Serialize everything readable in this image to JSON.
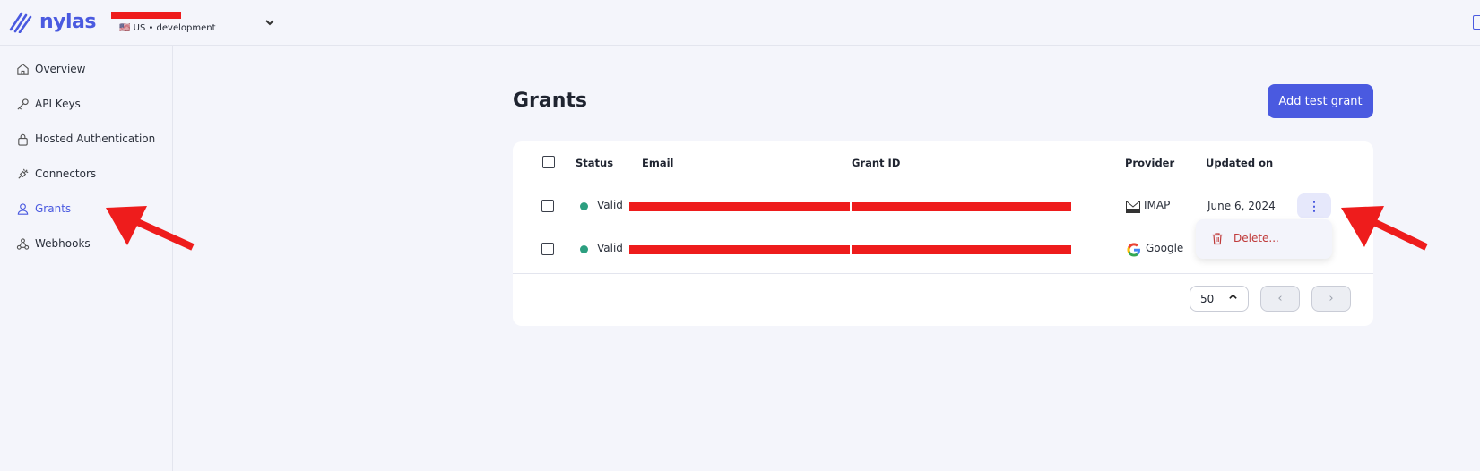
{
  "header": {
    "logo_text": "nylas",
    "env_label": "🇺🇸 US • development"
  },
  "sidebar": {
    "items": [
      {
        "label": "Overview",
        "icon": "home-icon"
      },
      {
        "label": "API Keys",
        "icon": "key-icon"
      },
      {
        "label": "Hosted Authentication",
        "icon": "lock-icon"
      },
      {
        "label": "Connectors",
        "icon": "plug-icon"
      },
      {
        "label": "Grants",
        "icon": "user-icon",
        "active": true
      },
      {
        "label": "Webhooks",
        "icon": "webhook-icon"
      }
    ]
  },
  "main": {
    "title": "Grants",
    "add_button": "Add test grant",
    "table": {
      "headers": [
        "Status",
        "Email",
        "Grant ID",
        "Provider",
        "Updated on"
      ],
      "rows": [
        {
          "status": "Valid",
          "provider": "IMAP",
          "updated": "June 6, 2024"
        },
        {
          "status": "Valid",
          "provider": "Google",
          "updated": ""
        }
      ]
    },
    "pagination": {
      "per_page": "50",
      "prev": "‹",
      "next": "›"
    },
    "row_menu": {
      "delete_label": "Delete..."
    }
  },
  "colors": {
    "accent": "#4a5ae0",
    "valid_dot": "#2c9f80",
    "danger": "#c03a3a",
    "annotation_arrow": "#ee1c1c",
    "redaction": "#ee1c1c"
  }
}
